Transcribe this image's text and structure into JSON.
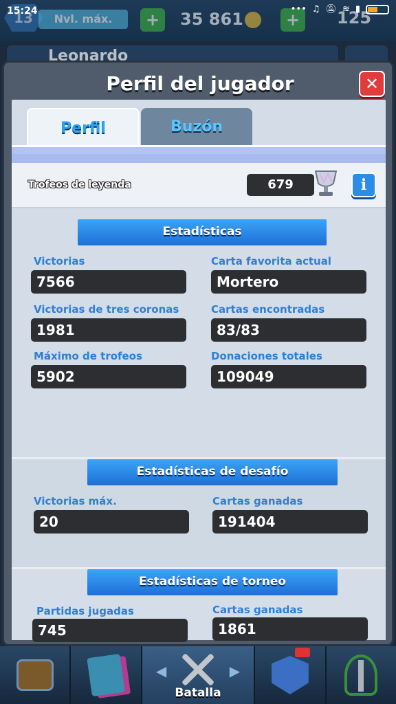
{
  "status_bar": {
    "time": "15:24",
    "icons": [
      "more-icon",
      "headphones-icon",
      "mute-icon",
      "wifi-icon",
      "signal-icon",
      "battery-icon"
    ]
  },
  "hud": {
    "level": "13",
    "level_label": "Nvl. máx.",
    "gold": "35 861",
    "gems": "125",
    "player_name": "Leonardo"
  },
  "modal": {
    "title": "Perfil del jugador",
    "close_label": "✕",
    "tabs": [
      {
        "label": "Perfil",
        "active": true
      },
      {
        "label": "Buzón",
        "active": false
      }
    ],
    "legend_trophies": {
      "label": "Trofeos de leyenda",
      "value": "679",
      "info_label": "i"
    }
  },
  "stats": {
    "heading": "Estadísticas",
    "items": [
      {
        "label": "Victorias",
        "value": "7566"
      },
      {
        "label": "Carta favorita actual",
        "value": "Mortero"
      },
      {
        "label": "Victorias de tres coronas",
        "value": "1981"
      },
      {
        "label": "Cartas encontradas",
        "value": "83/83"
      },
      {
        "label": "Máximo de trofeos",
        "value": "5902"
      },
      {
        "label": "Donaciones totales",
        "value": "109049"
      }
    ]
  },
  "challenge_stats": {
    "heading": "Estadísticas de desafío",
    "items": [
      {
        "label": "Victorias máx.",
        "value": "20"
      },
      {
        "label": "Cartas ganadas",
        "value": "191404"
      }
    ]
  },
  "tournament_stats": {
    "heading": "Estadísticas de torneo",
    "items": [
      {
        "label": "Partidas jugadas",
        "value": "745"
      },
      {
        "label": "Cartas ganadas",
        "value": "1861"
      }
    ]
  },
  "bottom_nav": {
    "items": [
      {
        "name": "shop",
        "icon": "chest-icon"
      },
      {
        "name": "cards",
        "icon": "cards-icon"
      },
      {
        "name": "battle",
        "icon": "swords-icon",
        "label": "Batalla",
        "active": true
      },
      {
        "name": "clan",
        "icon": "clan-icon"
      },
      {
        "name": "tournaments",
        "icon": "tournament-icon"
      }
    ]
  },
  "colors": {
    "accent_blue": "#2f7fd4",
    "close_red": "#e23b3b",
    "value_bg": "#2d2e31",
    "banner_blue": "#1e6fd8"
  }
}
